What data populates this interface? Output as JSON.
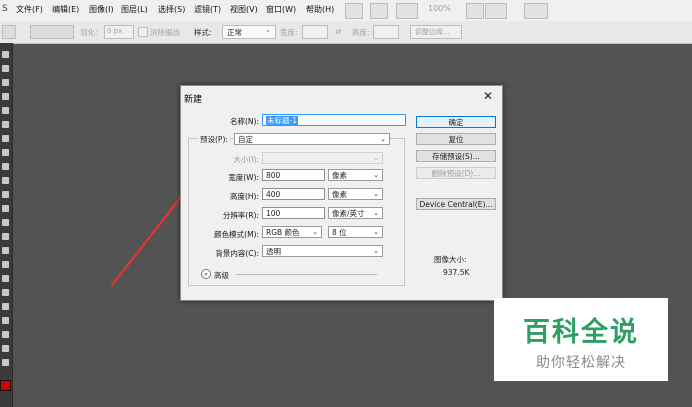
{
  "menubar": {
    "app_mark": "S",
    "items": [
      "文件(F)",
      "编辑(E)",
      "图像(I)",
      "图层(L)",
      "选择(S)",
      "滤镜(T)",
      "视图(V)",
      "窗口(W)",
      "帮助(H)"
    ],
    "zoom": "100%"
  },
  "optbar": {
    "feather_label": "羽化:",
    "feather_value": "0 px",
    "antialias_label": "消除锯齿",
    "style_label": "样式:",
    "style_value": "正常",
    "width_label": "宽度:",
    "height_label": "高度:",
    "refine_edge": "调整边缘..."
  },
  "dialog": {
    "title": "新建",
    "close_glyph": "✕",
    "name_label": "名称(N):",
    "name_value": "未标题-1",
    "preset_label": "预设(P):",
    "preset_value": "自定",
    "size_label": "大小(I):",
    "width_label": "宽度(W):",
    "width_value": "800",
    "width_unit": "像素",
    "height_label": "高度(H):",
    "height_value": "400",
    "height_unit": "像素",
    "resolution_label": "分辨率(R):",
    "resolution_value": "100",
    "resolution_unit": "像素/英寸",
    "color_mode_label": "颜色模式(M):",
    "color_mode_value": "RGB 颜色",
    "bit_depth": "8 位",
    "background_label": "背景内容(C):",
    "background_value": "透明",
    "advanced_label": "高级",
    "ok_button": "确定",
    "reset_button": "复位",
    "save_preset_button": "存储预设(S)...",
    "delete_preset_button": "删除预设(D)...",
    "device_central_button": "Device Central(E)...",
    "image_size_label": "图像大小:",
    "image_size_value": "937.5K"
  },
  "watermark": {
    "main": "百科全说",
    "sub": "助你轻松解决"
  },
  "colors": {
    "workspace": "#535353",
    "annotation_arrow": "#e8322f",
    "watermark_green": "#2e9e64"
  }
}
